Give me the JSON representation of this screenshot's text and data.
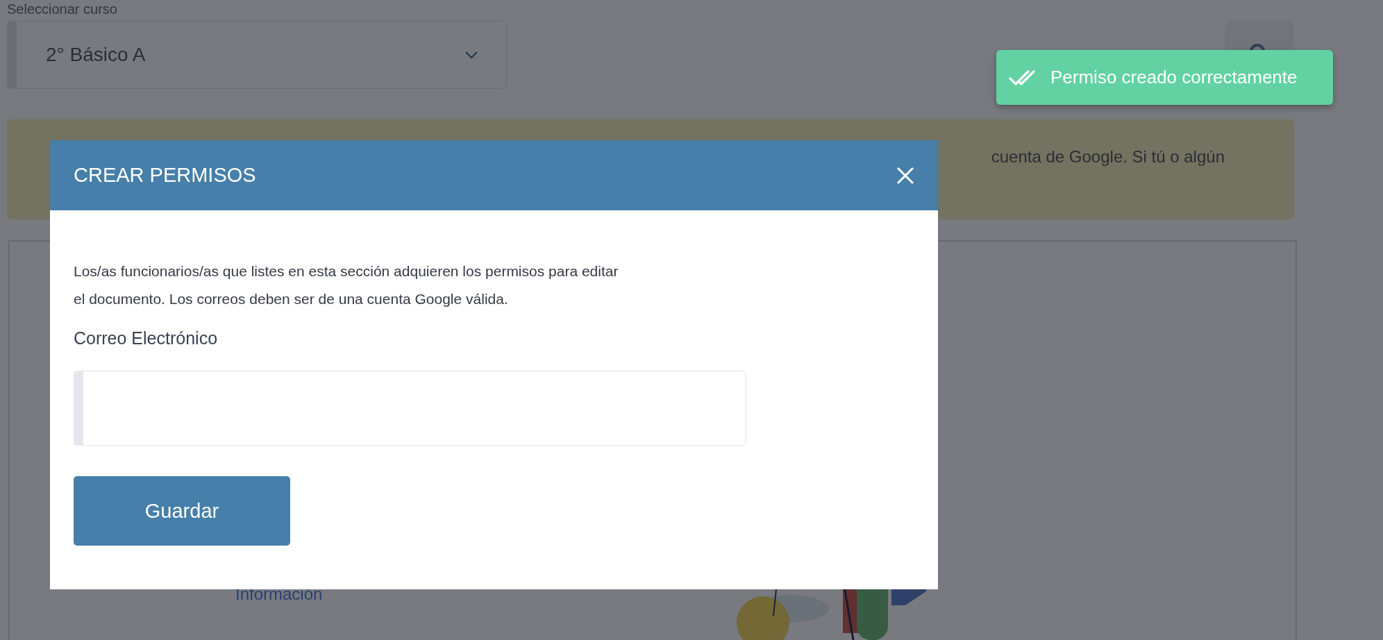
{
  "page": {
    "course_select": {
      "label": "Seleccionar curso",
      "value": "2° Básico A"
    },
    "banner": {
      "text": "cuenta de Google. Si tú o algún"
    },
    "card": {
      "link": "Información"
    }
  },
  "modal": {
    "title": "CREAR PERMISOS",
    "description": "Los/as funcionarios/as que listes en esta sección adquieren los permisos para editar el documento. Los correos deben ser de una cuenta Google válida.",
    "field_label": "Correo Electrónico",
    "save_button": "Guardar"
  },
  "toast": {
    "message": "Permiso creado correctamente"
  }
}
